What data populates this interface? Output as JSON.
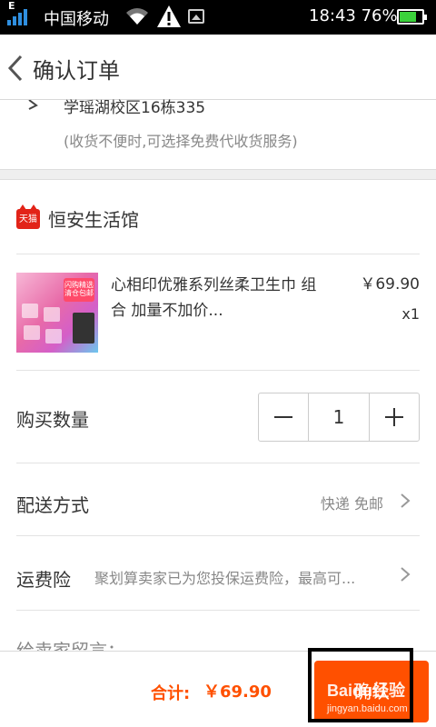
{
  "status_bar": {
    "network_type": "E",
    "carrier": "中国移动",
    "time": "18:43",
    "battery_percent": "76%",
    "battery_level": 0.76,
    "icons": [
      "signal-icon",
      "wifi-icon",
      "warning-icon",
      "image-icon",
      "battery-icon"
    ]
  },
  "header": {
    "title": "确认订单"
  },
  "address": {
    "line": "学瑶湖校区16栋335",
    "note": "(收货不便时,可选择免费代收货服务)"
  },
  "shop": {
    "badge": "天猫",
    "name": "恒安生活馆"
  },
  "product": {
    "name": "心相印优雅系列丝柔卫生巾 组合 加量不加价...",
    "price": "￥69.90",
    "quantity": "x1",
    "thumb_tag": "闪购精选 清仓包邮"
  },
  "purchase_qty": {
    "label": "购买数量",
    "value": "1"
  },
  "delivery": {
    "label": "配送方式",
    "value": "快递 免邮"
  },
  "insurance": {
    "label": "运费险",
    "value": "聚划算卖家已为您投保运费险，最高可..."
  },
  "message": {
    "label": "给卖家留言："
  },
  "footer": {
    "total_label": "合计:",
    "total_value": "￥69.90",
    "confirm_label": "确认"
  },
  "watermark": {
    "brand": "Baidu经验",
    "url": "jingyan.baidu.com"
  },
  "colors": {
    "accent": "#ff5000",
    "tmall_red": "#e22318",
    "battery_green": "#3bd13b"
  }
}
